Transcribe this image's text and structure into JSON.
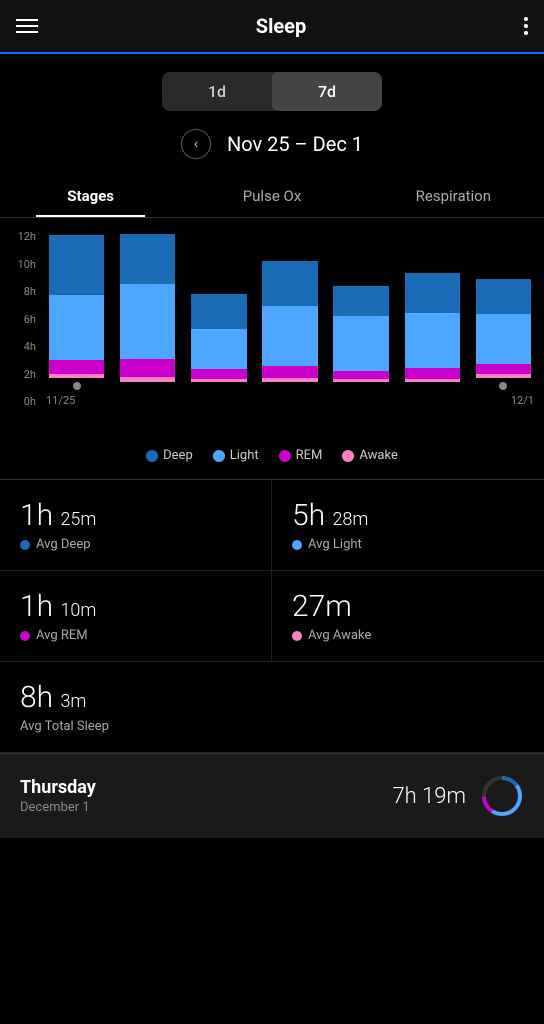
{
  "header": {
    "title": "Sleep",
    "menu_icon": "hamburger",
    "more_icon": "more-vertical"
  },
  "time_selector": {
    "options": [
      "1d",
      "7d"
    ],
    "active": "7d"
  },
  "date_nav": {
    "label": "Nov 25 – Dec 1",
    "prev_icon": "chevron-left",
    "next_icon": "chevron-right"
  },
  "tabs": [
    {
      "label": "Stages",
      "active": true
    },
    {
      "label": "Pulse Ox",
      "active": false
    },
    {
      "label": "Respiration",
      "active": false
    }
  ],
  "chart": {
    "y_labels": [
      "12h",
      "10h",
      "8h",
      "6h",
      "4h",
      "2h",
      "0h"
    ],
    "x_labels": [
      "11/25",
      "",
      "",
      "",
      "",
      "",
      "12/1"
    ],
    "bars": [
      {
        "deep": 60,
        "light": 65,
        "rem": 14,
        "awake": 4,
        "has_dot": true
      },
      {
        "deep": 50,
        "light": 75,
        "rem": 18,
        "awake": 5,
        "has_dot": false
      },
      {
        "deep": 35,
        "light": 40,
        "rem": 10,
        "awake": 3,
        "has_dot": false
      },
      {
        "deep": 45,
        "light": 60,
        "rem": 12,
        "awake": 4,
        "has_dot": false
      },
      {
        "deep": 30,
        "light": 55,
        "rem": 8,
        "awake": 3,
        "has_dot": false
      },
      {
        "deep": 40,
        "light": 55,
        "rem": 11,
        "awake": 3,
        "has_dot": false
      },
      {
        "deep": 35,
        "light": 50,
        "rem": 10,
        "awake": 4,
        "has_dot": true
      }
    ],
    "colors": {
      "deep": "#1a6bb5",
      "light": "#4da6ff",
      "rem": "#cc00cc",
      "awake": "#ff80c0"
    }
  },
  "legend": [
    {
      "label": "Deep",
      "color": "#1a6bb5"
    },
    {
      "label": "Light",
      "color": "#4da6ff"
    },
    {
      "label": "REM",
      "color": "#cc00cc"
    },
    {
      "label": "Awake",
      "color": "#ff80c0"
    }
  ],
  "stats": [
    {
      "value": "1h",
      "value2": "25m",
      "label": "Avg Deep",
      "color": "#1a6bb5"
    },
    {
      "value": "5h",
      "value2": "28m",
      "label": "Avg Light",
      "color": "#4da6ff"
    },
    {
      "value": "1h",
      "value2": "10m",
      "label": "Avg REM",
      "color": "#cc00cc"
    },
    {
      "value": "27m",
      "value2": "",
      "label": "Avg Awake",
      "color": "#ff80c0"
    }
  ],
  "total_sleep": {
    "value": "8h",
    "value2": "3m",
    "label": "Avg Total Sleep"
  },
  "bottom_card": {
    "day_name": "Thursday",
    "day_date": "December 1",
    "duration": "7h 19m",
    "donut_colors": {
      "deep": "#1a6bb5",
      "light": "#4da6ff",
      "rim": "#cc00cc"
    }
  }
}
